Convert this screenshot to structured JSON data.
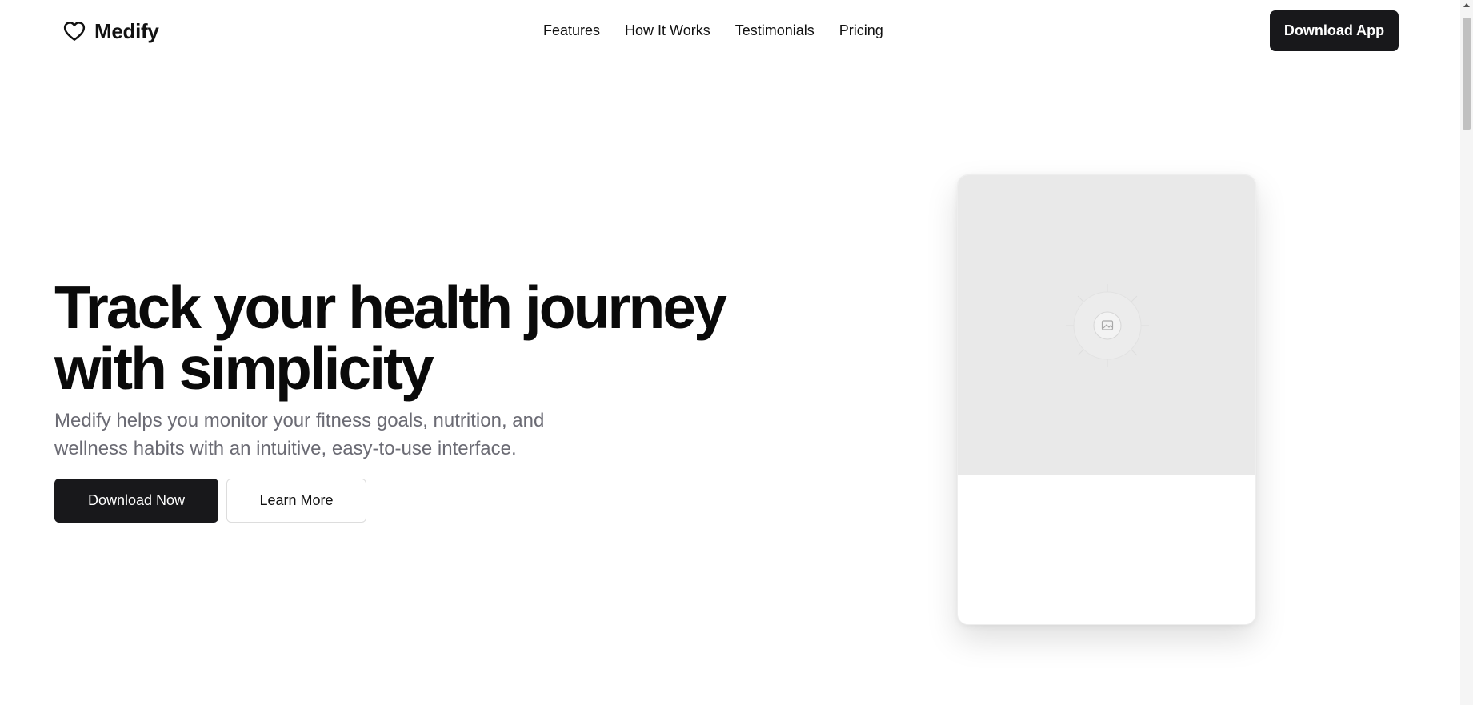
{
  "brand": {
    "name": "Medify",
    "icon": "heart-outline-icon"
  },
  "nav": {
    "items": [
      "Features",
      "How It Works",
      "Testimonials",
      "Pricing"
    ]
  },
  "header": {
    "cta_label": "Download App"
  },
  "hero": {
    "title_line1": "Track your health journey",
    "title_line2": "with simplicity",
    "subtitle_line1": "Medify helps you monitor your fitness goals, nutrition, and",
    "subtitle_line2": "wellness habits with an intuitive, easy-to-use interface.",
    "primary_label": "Download Now",
    "secondary_label": "Learn More"
  },
  "preview_card": {
    "image_icon": "image-placeholder-icon"
  },
  "colors": {
    "primary": "#18181b",
    "muted_text": "#6b6b74",
    "placeholder_bg": "#e9e9e9"
  }
}
